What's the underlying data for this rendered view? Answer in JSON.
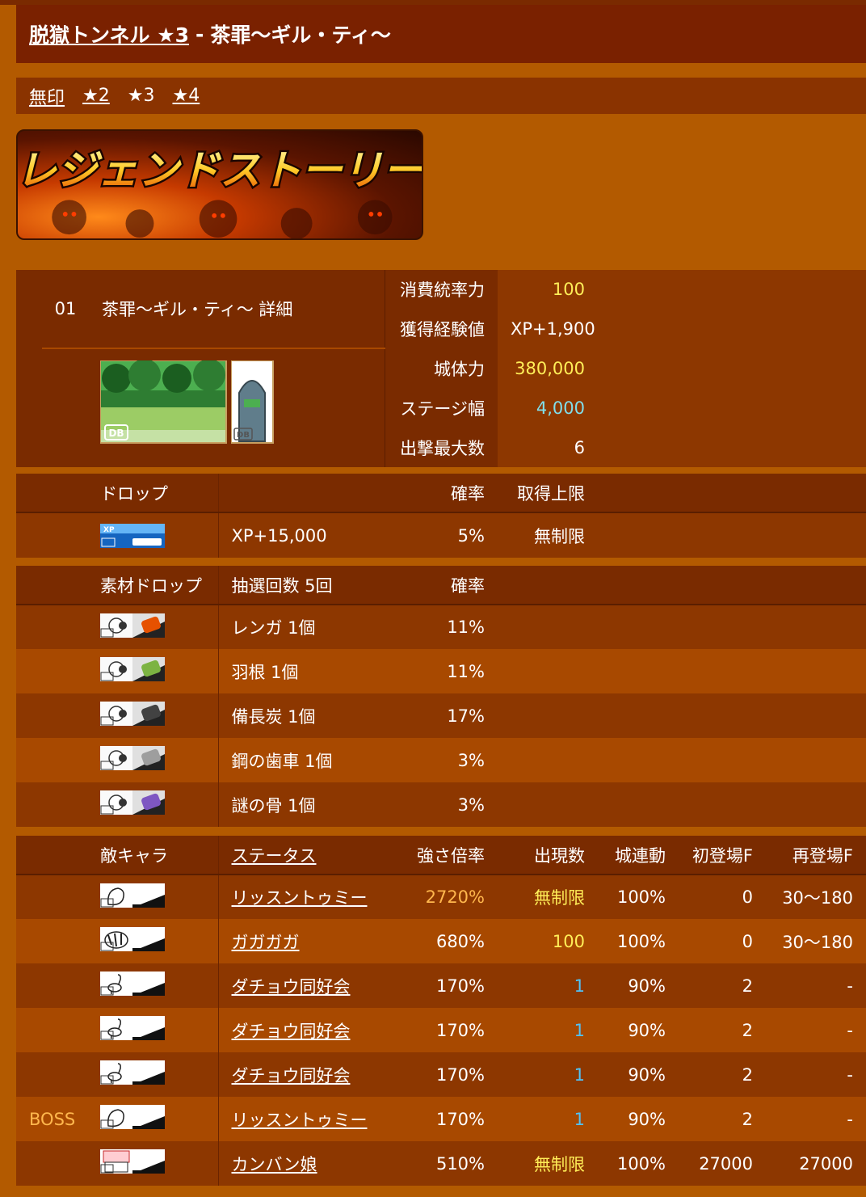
{
  "header": {
    "map_link": "脱獄トンネル ★3",
    "separator": "-",
    "stage_name": "茶罪〜ギル・ティ〜"
  },
  "star_nav": [
    {
      "label": "無印",
      "link": true
    },
    {
      "label": "★2",
      "link": true
    },
    {
      "label": "★3",
      "link": false
    },
    {
      "label": "★4",
      "link": true
    }
  ],
  "banner": {
    "text": "レジェンドストーリー"
  },
  "stage": {
    "number": "01",
    "name": "茶罪〜ギル・ティ〜 詳細",
    "rows": [
      {
        "label": "消費統率力",
        "value": "100",
        "color": "#ffee58"
      },
      {
        "label": "獲得経験値",
        "value": "XP+1,900",
        "color": "#ffffff"
      },
      {
        "label": "城体力",
        "value": "380,000",
        "color": "#ffee58"
      },
      {
        "label": "ステージ幅",
        "value": "4,000",
        "color": "#80deea"
      },
      {
        "label": "出撃最大数",
        "value": "6",
        "color": "#ffffff"
      }
    ],
    "db_label": "DB"
  },
  "drop": {
    "headers": {
      "item": "ドロップ",
      "rate": "確率",
      "limit": "取得上限"
    },
    "rows": [
      {
        "icon": "xp-icon",
        "name": "XP+15,000",
        "rate": "5%",
        "limit": "無制限"
      }
    ]
  },
  "material": {
    "headers": {
      "item": "素材ドロップ",
      "draws": "抽選回数 5回",
      "rate": "確率"
    },
    "rows": [
      {
        "icon": "brick-icon",
        "name": "レンガ 1個",
        "rate": "11%",
        "accent": "#e65100"
      },
      {
        "icon": "feather-icon",
        "name": "羽根 1個",
        "rate": "11%",
        "accent": "#7cb342"
      },
      {
        "icon": "charcoal-icon",
        "name": "備長炭 1個",
        "rate": "17%",
        "accent": "#424242"
      },
      {
        "icon": "gear-icon",
        "name": "鋼の歯車 1個",
        "rate": "3%",
        "accent": "#9e9e9e"
      },
      {
        "icon": "bone-icon",
        "name": "謎の骨 1個",
        "rate": "3%",
        "accent": "#7e57c2"
      }
    ]
  },
  "enemies": {
    "headers": {
      "enemy": "敵キャラ",
      "status": "ステータス",
      "magnification": "強さ倍率",
      "count": "出現数",
      "castle": "城連動",
      "first": "初登場F",
      "respawn": "再登場F"
    },
    "rows": [
      {
        "tag": "",
        "icon": "squirrel-icon",
        "name": "リッスントゥミー",
        "mag": "2720%",
        "mag_color": "#ffb74d",
        "count": "無制限",
        "count_color": "#ffee58",
        "castle": "100%",
        "first": "0",
        "respawn": "30〜180"
      },
      {
        "tag": "",
        "icon": "zebra-icon",
        "name": "ガガガガ",
        "mag": "680%",
        "mag_color": "#ffffff",
        "count": "100",
        "count_color": "#ffee58",
        "castle": "100%",
        "first": "0",
        "respawn": "30〜180"
      },
      {
        "tag": "",
        "icon": "ostrich-icon",
        "name": "ダチョウ同好会",
        "mag": "170%",
        "mag_color": "#ffffff",
        "count": "1",
        "count_color": "#4fc3f7",
        "castle": "90%",
        "first": "2",
        "respawn": "-"
      },
      {
        "tag": "",
        "icon": "ostrich-icon",
        "name": "ダチョウ同好会",
        "mag": "170%",
        "mag_color": "#ffffff",
        "count": "1",
        "count_color": "#4fc3f7",
        "castle": "90%",
        "first": "2",
        "respawn": "-"
      },
      {
        "tag": "",
        "icon": "ostrich-icon",
        "name": "ダチョウ同好会",
        "mag": "170%",
        "mag_color": "#ffffff",
        "count": "1",
        "count_color": "#4fc3f7",
        "castle": "90%",
        "first": "2",
        "respawn": "-"
      },
      {
        "tag": "BOSS",
        "icon": "squirrel-icon",
        "name": "リッスントゥミー",
        "mag": "170%",
        "mag_color": "#ffffff",
        "count": "1",
        "count_color": "#4fc3f7",
        "castle": "90%",
        "first": "2",
        "respawn": "-"
      },
      {
        "tag": "",
        "icon": "signboard-girl-icon",
        "name": "カンバン娘",
        "mag": "510%",
        "mag_color": "#ffffff",
        "count": "無制限",
        "count_color": "#ffee58",
        "castle": "100%",
        "first": "27000",
        "respawn": "27000"
      }
    ]
  },
  "colors": {
    "background": "#b35a00",
    "row_dark": "#7a2b00",
    "row_mid": "#8d3700",
    "row_light": "#a84900",
    "boss_tag": "#ffb74d"
  }
}
